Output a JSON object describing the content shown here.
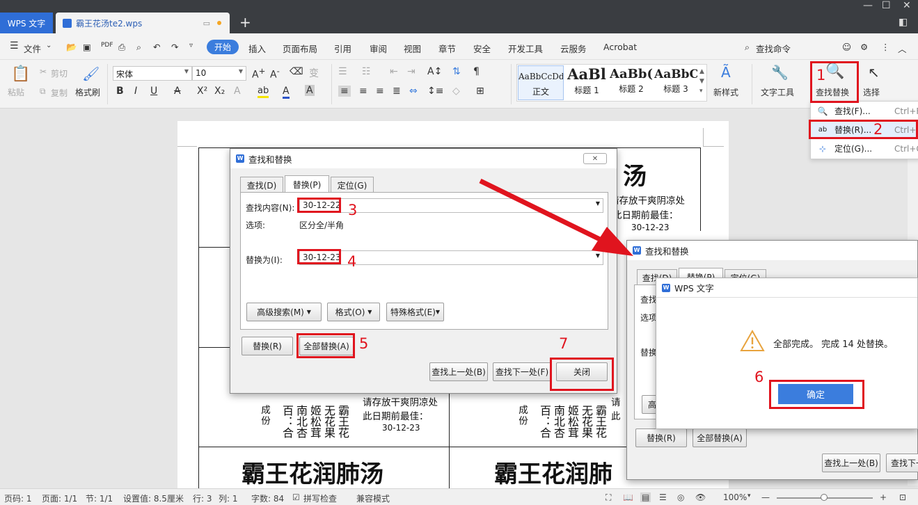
{
  "titlebar": {
    "app_tab": "WPS 文字",
    "doc_tab": "霸王花汤te2.wps",
    "new_tab": "+"
  },
  "menubar": {
    "file": "文件",
    "items": [
      "开始",
      "插入",
      "页面布局",
      "引用",
      "审阅",
      "视图",
      "章节",
      "安全",
      "开发工具",
      "云服务",
      "Acrobat"
    ],
    "search": "查找命令"
  },
  "ribbon": {
    "paste": "粘贴",
    "cut": "剪切",
    "copy": "复制",
    "format_painter": "格式刷",
    "font": "宋体",
    "size": "10",
    "styles": [
      {
        "preview": "AaBbCcDd",
        "label": "正文"
      },
      {
        "preview": "AaBl",
        "label": "标题 1"
      },
      {
        "preview": "AaBb(",
        "label": "标题 2"
      },
      {
        "preview": "AaBbC",
        "label": "标题 3"
      }
    ],
    "new_style": "新样式",
    "text_tools": "文字工具",
    "find_replace": "查找替换",
    "select": "选择"
  },
  "dropdown": [
    {
      "label": "查找(F)...",
      "shortcut": "Ctrl+F"
    },
    {
      "label": "替换(R)...",
      "shortcut": "Ctrl+H"
    },
    {
      "label": "定位(G)...",
      "shortcut": "Ctrl+G"
    }
  ],
  "document": {
    "heading": "霸王花润肺汤",
    "heading_partial": "霸王花润肺",
    "heading_right_top": "汤",
    "storage": "请存放干爽阴凉处",
    "bestbefore": "此日期前最佳：",
    "date": "30-12-23",
    "ingredients_label": "成份",
    "ingredients_col1": "百：合",
    "ingredients_col2": "南北杏",
    "ingredients_col3": "姬松茸",
    "ingredients_col4": "无花果",
    "ingredients_col5": "霸王花",
    "partial_r": "请",
    "partial_r2": "此"
  },
  "dialog_main": {
    "title": "查找和替换",
    "tabs": [
      "查找(D)",
      "替换(P)",
      "定位(G)"
    ],
    "find_label": "查找内容(N):",
    "find_value": "30-12-22",
    "options_label": "选项:",
    "options_value": "区分全/半角",
    "replace_label": "替换为(I):",
    "replace_value": "30-12-23",
    "advanced": "高级搜索(M)",
    "format": "格式(O)",
    "special": "特殊格式(E)",
    "replace_btn": "替换(R)",
    "replace_all": "全部替换(A)",
    "find_prev": "查找上一处(B)",
    "find_next": "查找下一处(F)",
    "close": "关闭"
  },
  "dialog_back": {
    "title": "查找和替换",
    "tabs": [
      "查找(D)",
      "替换(P)",
      "定位(G)"
    ],
    "find_label": "查找",
    "options_label": "选项",
    "replace_label": "替换",
    "adv_partial": "高",
    "replace_btn": "替换(R)",
    "replace_all": "全部替换(A)",
    "find_prev": "查找上一处(B)",
    "find_next": "查找下一"
  },
  "dialog_msg": {
    "title": "WPS 文字",
    "message": "全部完成。 完成 14 处替换。",
    "ok": "确定"
  },
  "annotations": [
    "1",
    "2",
    "3",
    "4",
    "5",
    "6",
    "7"
  ],
  "statusbar": {
    "page": "页码: 1",
    "pages": "页面: 1/1",
    "section": "节: 1/1",
    "setting": "设置值: 8.5厘米",
    "row": "行: 3",
    "col": "列: 1",
    "words": "字数: 84",
    "spell": "拼写检查",
    "compat": "兼容模式",
    "zoom": "100%"
  },
  "colors": {
    "accent": "#3b7ddd",
    "annotation": "#e0141e",
    "ok_button": "#3b7ddd"
  }
}
